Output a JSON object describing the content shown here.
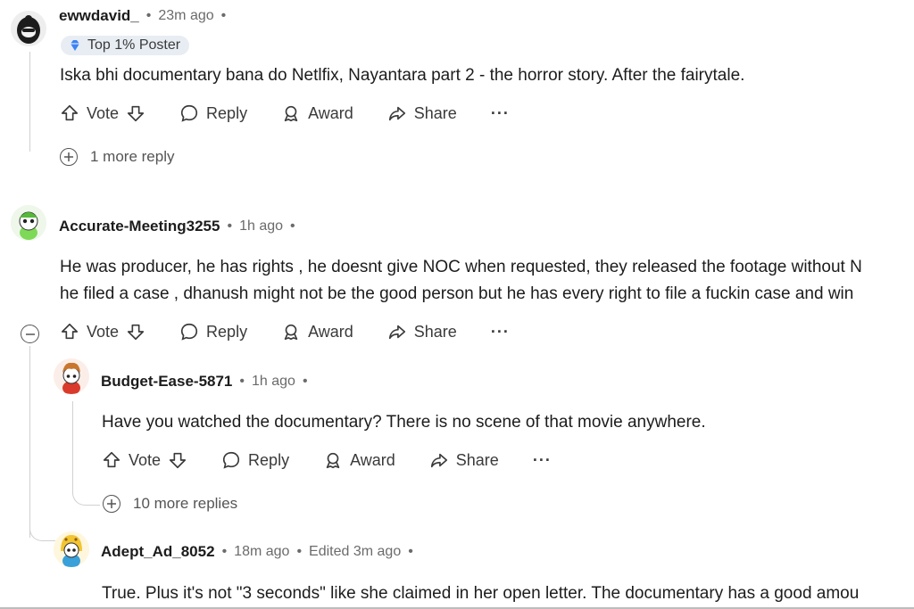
{
  "actions": {
    "vote": "Vote",
    "reply": "Reply",
    "award": "Award",
    "share": "Share",
    "more": "···"
  },
  "comments": [
    {
      "username": "ewwdavid_",
      "time": "23m ago",
      "badge": "Top 1% Poster",
      "body": [
        "Iska bhi documentary bana do Netlfix, Nayantara part 2 - the horror story. After the fairytale."
      ],
      "more_replies": "1 more reply"
    },
    {
      "username": "Accurate-Meeting3255",
      "time": "1h ago",
      "body": [
        "He was producer, he has rights , he doesnt give NOC when requested, they released the footage without N",
        "he filed a case , dhanush might not be the good person but he has every right to file a fuckin case and win"
      ]
    },
    {
      "username": "Budget-Ease-5871",
      "time": "1h ago",
      "body": [
        "Have you watched the documentary? There is no scene of that movie anywhere."
      ],
      "more_replies": "10 more replies"
    },
    {
      "username": "Adept_Ad_8052",
      "time": "18m ago",
      "edited": "Edited 3m ago",
      "body": [
        "True. Plus it's not \"3 seconds\" like she claimed in her open letter. The documentary has a good amou"
      ]
    }
  ],
  "separator": "•"
}
